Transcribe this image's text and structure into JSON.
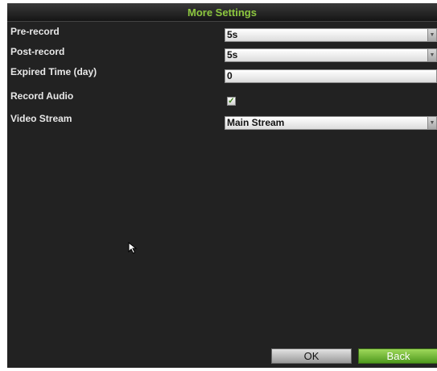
{
  "dialog": {
    "title": "More Settings"
  },
  "fields": {
    "prerecord": {
      "label": "Pre-record",
      "value": "5s"
    },
    "postrecord": {
      "label": "Post-record",
      "value": "5s"
    },
    "expired": {
      "label": "Expired Time (day)",
      "value": "0"
    },
    "audio": {
      "label": "Record Audio",
      "checked": true
    },
    "stream": {
      "label": "Video Stream",
      "value": "Main Stream"
    }
  },
  "buttons": {
    "ok": "OK",
    "back": "Back"
  },
  "colors": {
    "title": "#8dc73f",
    "back_button": "#5fae2a",
    "panel_background": "#222222"
  },
  "icons": {
    "dropdown": "triangle-down",
    "checkbox_mark": "check-mark",
    "cursor": "mouse-pointer"
  }
}
